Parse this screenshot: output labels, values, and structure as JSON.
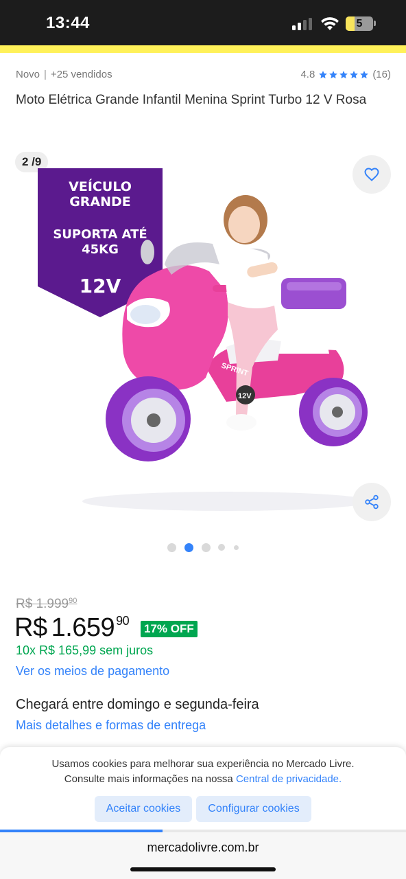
{
  "status_bar": {
    "time": "13:44",
    "battery_level": "5"
  },
  "product": {
    "condition": "Novo",
    "sold": "+25 vendidos",
    "rating_value": "4.8",
    "stars": 5,
    "review_count": "(16)",
    "title": "Moto Elétrica Grande Infantil Menina Sprint Turbo 12 V Rosa"
  },
  "gallery": {
    "counter": "2 /9",
    "banner": {
      "line1": "VEÍCULO GRANDE",
      "line2": "SUPORTA ATÉ 45KG",
      "line3": "12V"
    },
    "image_labels": {
      "brand": "SPRINT",
      "voltage": "12V"
    },
    "dot_count": 5,
    "active_dot": 1
  },
  "pricing": {
    "old_price_currency": "R$",
    "old_price_int": "1.999",
    "old_price_cents": "90",
    "price_currency": "R$",
    "price_int": "1.659",
    "price_cents": "90",
    "discount": "17% OFF",
    "installments": "10x R$ 165,99 sem juros",
    "payment_link": "Ver os meios de pagamento"
  },
  "shipping": {
    "delivery_text": "Chegará entre domingo e segunda-feira",
    "details_link": "Mais detalhes e formas de entrega"
  },
  "cookie_banner": {
    "message_line1": "Usamos cookies para melhorar sua experiência no Mercado Livre.",
    "message_line2_prefix": "Consulte mais informações na nossa",
    "privacy_link": "Central de privacidade.",
    "accept_label": "Aceitar cookies",
    "configure_label": "Configurar cookies"
  },
  "browser": {
    "url": "mercadolivre.com.br",
    "load_progress": 0.4
  },
  "colors": {
    "accent_blue": "#3483fa",
    "success_green": "#00a650",
    "brand_yellow": "#fff159",
    "banner_purple": "#5b1a8e"
  },
  "icons": [
    "heart-icon",
    "share-icon",
    "star-icon",
    "wifi-icon",
    "signal-icon",
    "battery-icon"
  ]
}
